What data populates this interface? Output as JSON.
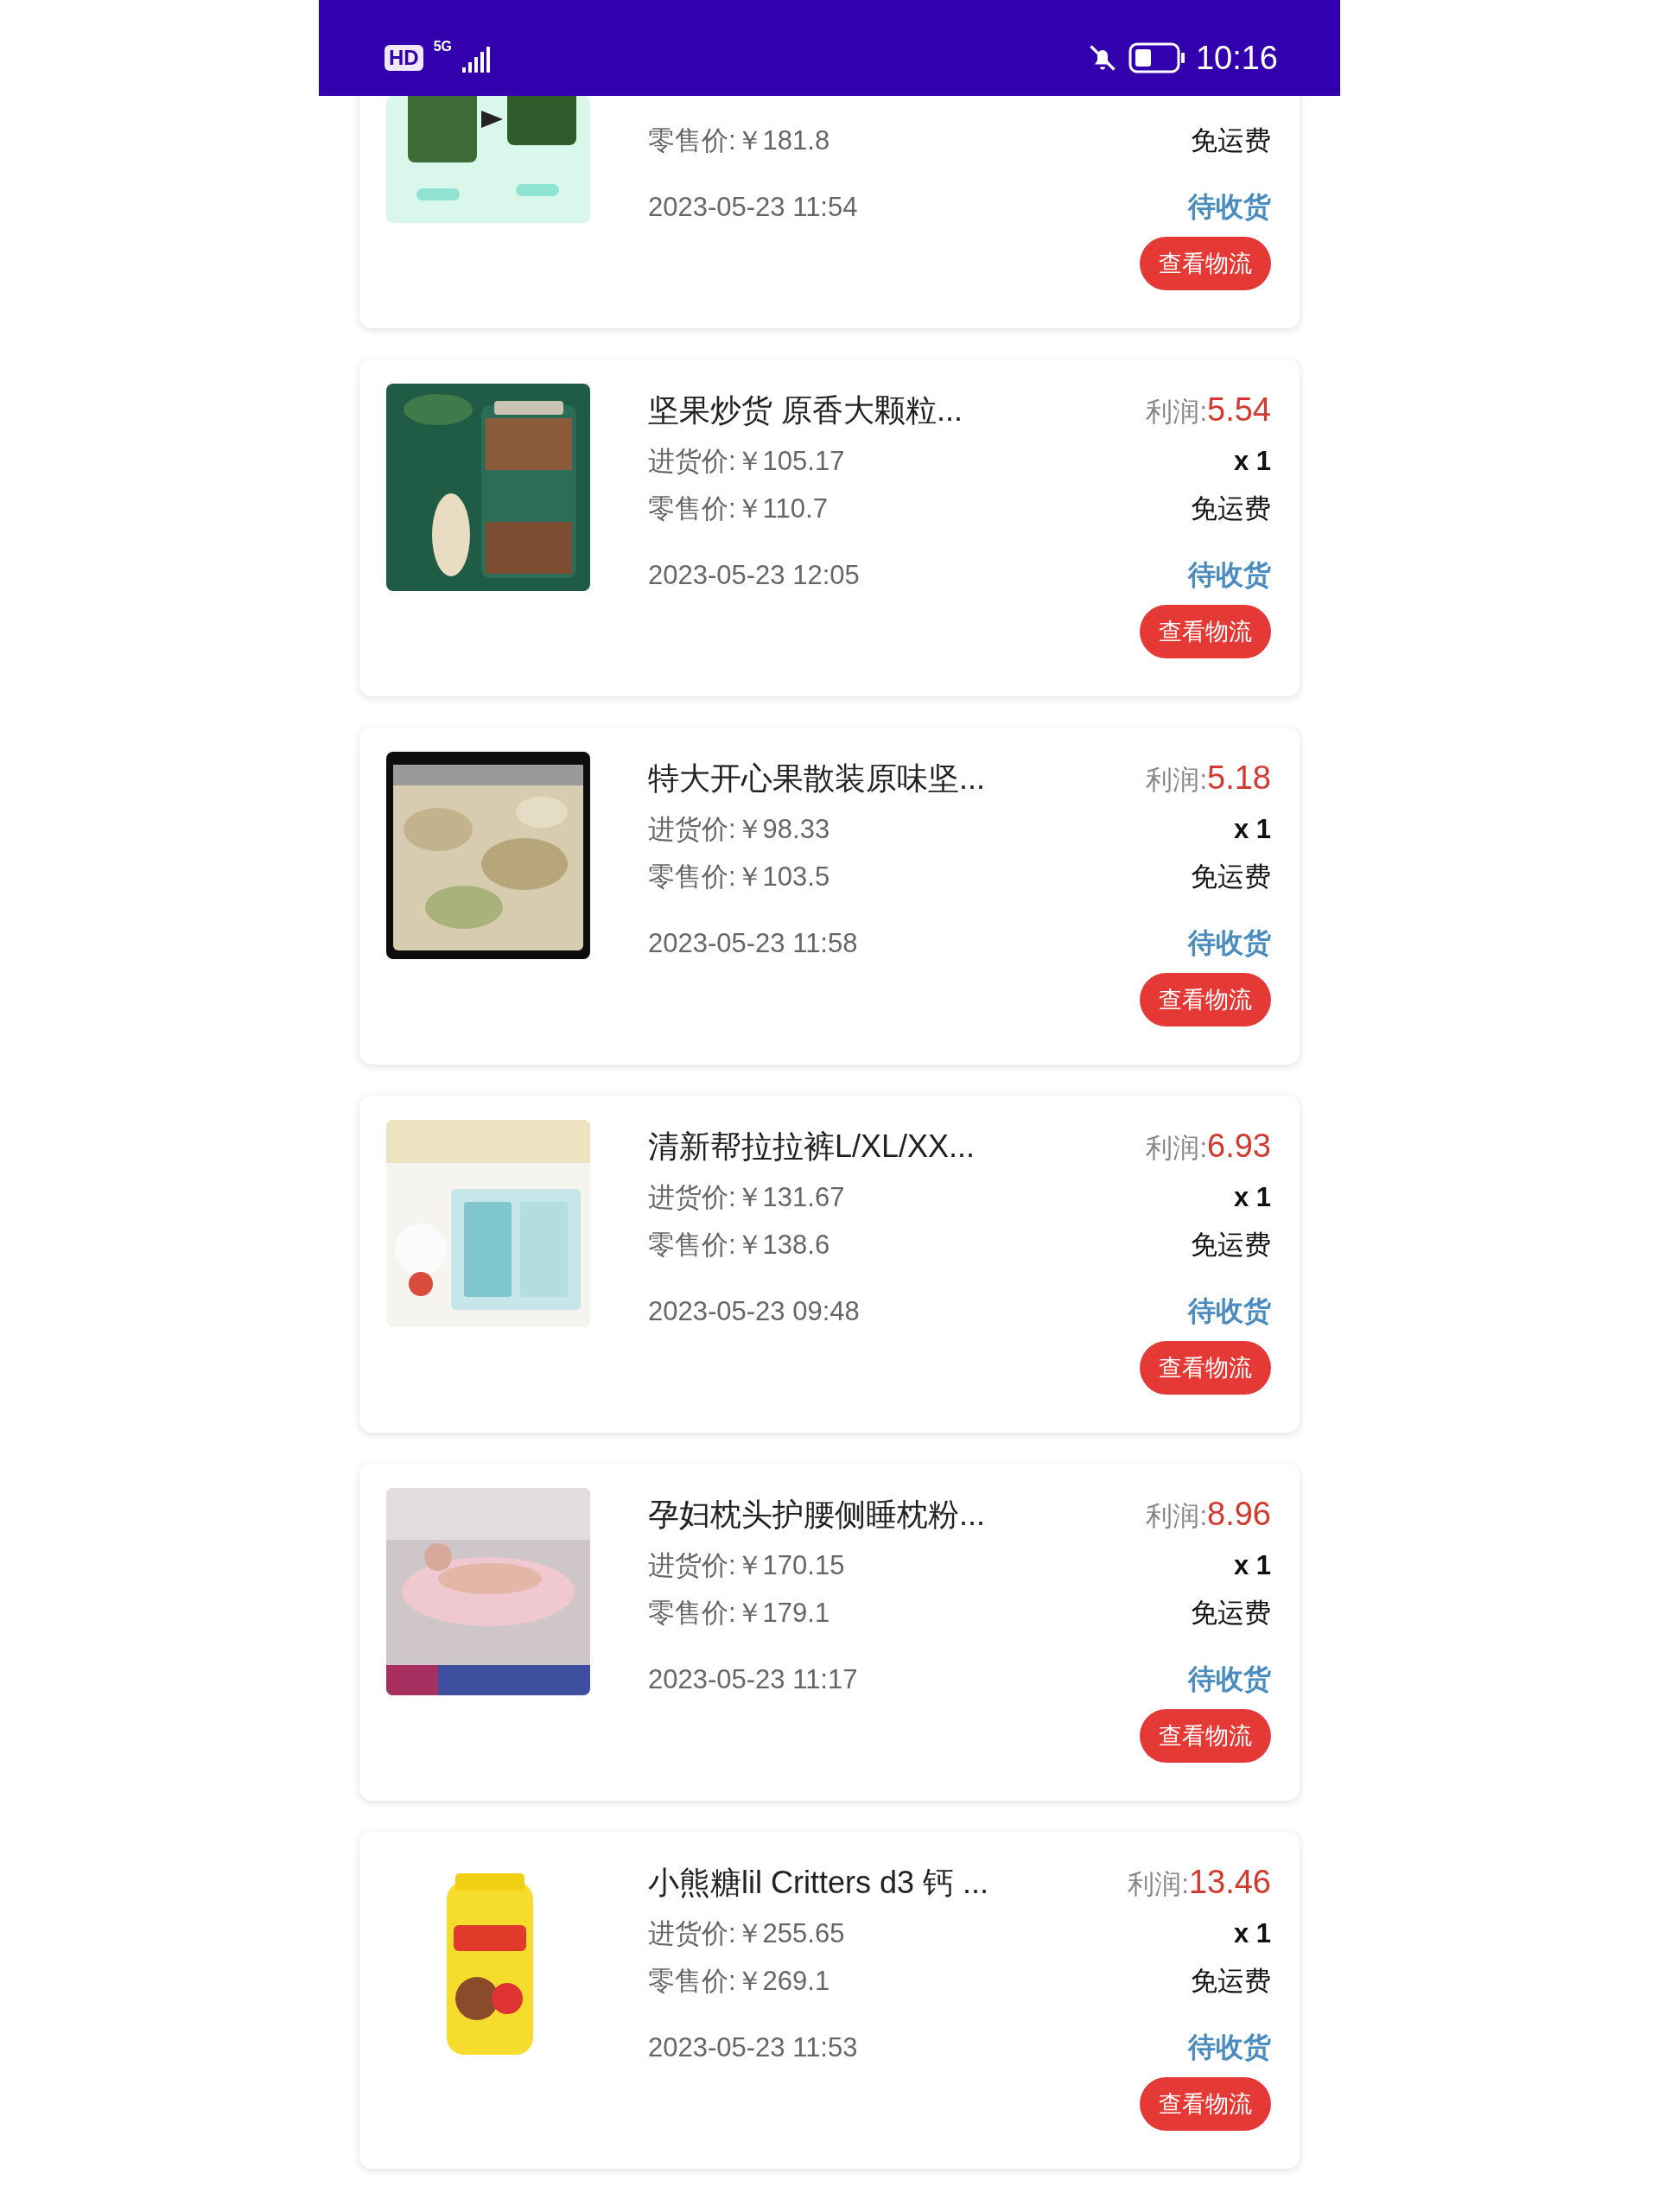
{
  "status_bar": {
    "network_badge": "HD",
    "network_type": "5G",
    "time": "10:16"
  },
  "orders": [
    {
      "retail_price": "零售价:￥181.8",
      "shipping": "免运费",
      "date": "2023-05-23 11:54",
      "status": "待收货",
      "action": "查看物流"
    },
    {
      "title": "坚果炒货 原香大颗粒...",
      "profit_label": "利润:",
      "profit": "5.54",
      "purchase_price": "进货价:￥105.17",
      "quantity": "x 1",
      "retail_price": "零售价:￥110.7",
      "shipping": "免运费",
      "date": "2023-05-23 12:05",
      "status": "待收货",
      "action": "查看物流"
    },
    {
      "title": "特大开心果散装原味坚...",
      "profit_label": "利润:",
      "profit": "5.18",
      "purchase_price": "进货价:￥98.33",
      "quantity": "x 1",
      "retail_price": "零售价:￥103.5",
      "shipping": "免运费",
      "date": "2023-05-23 11:58",
      "status": "待收货",
      "action": "查看物流"
    },
    {
      "title": "清新帮拉拉裤L/XL/XX...",
      "profit_label": "利润:",
      "profit": "6.93",
      "purchase_price": "进货价:￥131.67",
      "quantity": "x 1",
      "retail_price": "零售价:￥138.6",
      "shipping": "免运费",
      "date": "2023-05-23 09:48",
      "status": "待收货",
      "action": "查看物流"
    },
    {
      "title": "孕妇枕头护腰侧睡枕粉...",
      "profit_label": "利润:",
      "profit": "8.96",
      "purchase_price": "进货价:￥170.15",
      "quantity": "x 1",
      "retail_price": "零售价:￥179.1",
      "shipping": "免运费",
      "date": "2023-05-23 11:17",
      "status": "待收货",
      "action": "查看物流"
    },
    {
      "title": "小熊糖lil Critters d3 钙 ...",
      "profit_label": "利润:",
      "profit": "13.46",
      "purchase_price": "进货价:￥255.65",
      "quantity": "x 1",
      "retail_price": "零售价:￥269.1",
      "shipping": "免运费",
      "date": "2023-05-23 11:53",
      "status": "待收货",
      "action": "查看物流"
    }
  ]
}
